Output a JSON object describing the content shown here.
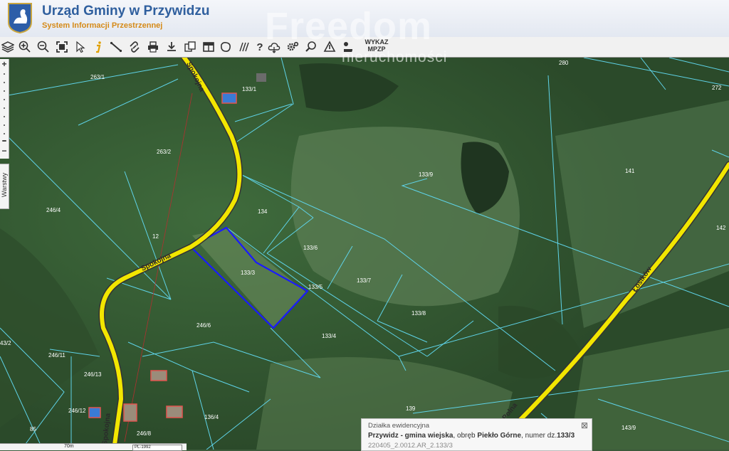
{
  "header": {
    "title": "Urząd Gminy w Przywidzu",
    "subtitle": "System Informacji Przestrzennej",
    "logo_icon": "swan-crest-icon"
  },
  "toolbar": {
    "tools": [
      "layers-icon",
      "zoom-in-icon",
      "zoom-out-icon",
      "zoom-extent-icon",
      "select-arrow-icon",
      "info-icon",
      "measure-distance-icon",
      "link-icon",
      "print-icon",
      "download-icon",
      "copy-icon",
      "layout-icon",
      "area-icon",
      "hatch-icon",
      "help-icon",
      "cloud-icon",
      "settings-icon",
      "search-icon",
      "triangle-icon",
      "marker-icon"
    ],
    "wykaz_line1": "WYKAZ",
    "wykaz_line2": "MPZP"
  },
  "watermark": {
    "brand": "Freedom",
    "sub": "nieruchomości"
  },
  "map": {
    "roads": [
      "Spokojna",
      "Spokojna",
      "Spokojna",
      "Łośików",
      "Polna"
    ],
    "parcels": [
      "263/1",
      "133/1",
      "280",
      "272",
      "263/2",
      "133/9",
      "141",
      "246/4",
      "134",
      "142",
      "133/6",
      "133/3",
      "133/5",
      "133/7",
      "133/8",
      "246/6",
      "133/4",
      "43/2",
      "246/11",
      "246/13",
      "246/12",
      "136/4",
      "139",
      "85",
      "246/8",
      "143/9",
      "12"
    ],
    "selected_parcel": "133/3"
  },
  "side": {
    "zoom_plus": "+",
    "zoom_minus": "−",
    "layers_label": "Warstwy"
  },
  "info_panel": {
    "caption": "Działka ewidencyjna",
    "name": "Przywidz - gmina wiejska",
    "mid": ", obręb ",
    "obreb": "Piekło Górne",
    "numlbl": ", numer dz.",
    "number": "133/3",
    "id": "220405_2.0012.AR_2.133/3",
    "close": "⊠"
  },
  "scale": {
    "label": "70m",
    "crs": "PL-1992"
  },
  "colors": {
    "road": "#f2e600",
    "parcel_line": "#5fd3e8",
    "selection": "#1a1aff",
    "title": "#2f5f9e",
    "subtitle": "#d58a18"
  }
}
